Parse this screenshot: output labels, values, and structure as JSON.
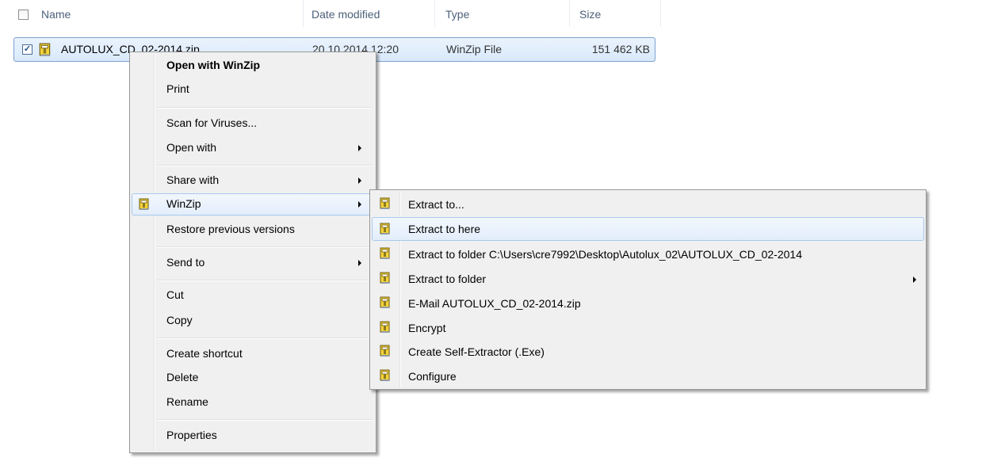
{
  "columns": {
    "name": "Name",
    "date_modified": "Date modified",
    "type": "Type",
    "size": "Size"
  },
  "file": {
    "name": "AUTOLUX_CD_02-2014.zip",
    "date": "20.10.2014 12:20",
    "type": "WinZip File",
    "size": "151 462 KB",
    "checked": true
  },
  "context_menu": {
    "items": [
      {
        "label": "Open with WinZip",
        "bold": true
      },
      {
        "label": "Print"
      },
      {
        "label": "Scan for Viruses..."
      },
      {
        "label": "Open with",
        "submenu": true
      },
      {
        "label": "Share with",
        "submenu": true
      },
      {
        "label": "WinZip",
        "submenu": true,
        "icon": "winzip-icon",
        "highlighted": true
      },
      {
        "label": "Restore previous versions"
      },
      {
        "label": "Send to",
        "submenu": true
      },
      {
        "label": "Cut"
      },
      {
        "label": "Copy"
      },
      {
        "label": "Create shortcut"
      },
      {
        "label": "Delete"
      },
      {
        "label": "Rename"
      },
      {
        "label": "Properties"
      }
    ]
  },
  "winzip_submenu": {
    "items": [
      {
        "label": "Extract to...",
        "icon": "winzip-icon"
      },
      {
        "label": "Extract to here",
        "icon": "winzip-icon",
        "highlighted": true
      },
      {
        "label": "Extract to folder C:\\Users\\cre7992\\Desktop\\Autolux_02\\AUTOLUX_CD_02-2014",
        "icon": "winzip-icon"
      },
      {
        "label": "Extract to folder",
        "icon": "winzip-icon",
        "submenu": true
      },
      {
        "label": "E-Mail AUTOLUX_CD_02-2014.zip",
        "icon": "winzip-icon"
      },
      {
        "label": "Encrypt",
        "icon": "winzip-icon"
      },
      {
        "label": "Create Self-Extractor (.Exe)",
        "icon": "winzip-icon"
      },
      {
        "label": "Configure",
        "icon": "winzip-icon"
      }
    ]
  }
}
